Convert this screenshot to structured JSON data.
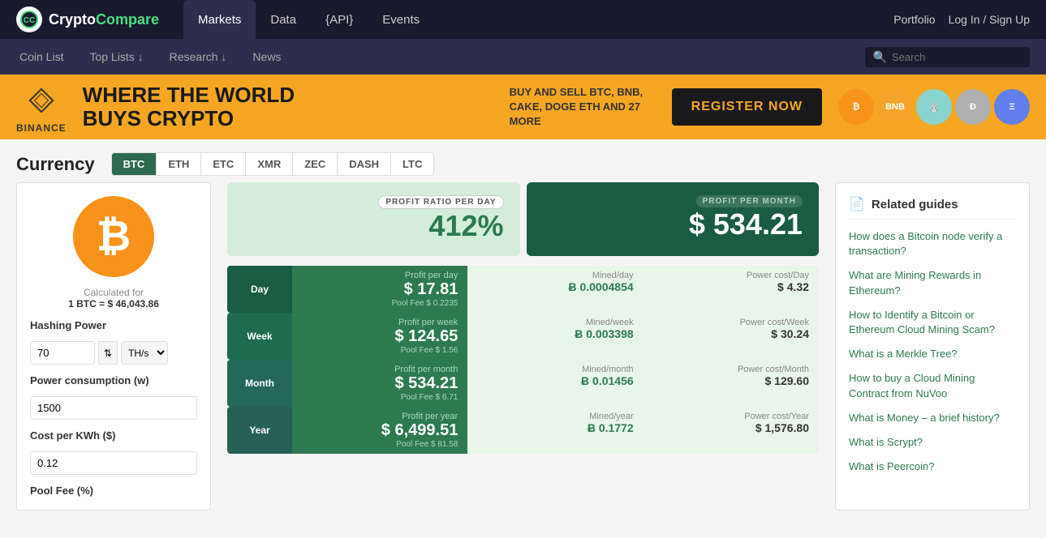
{
  "site": {
    "logo_text_crypto": "Crypto",
    "logo_text_compare": "Compare"
  },
  "top_nav": {
    "links": [
      {
        "label": "Markets",
        "active": true
      },
      {
        "label": "Data",
        "active": false
      },
      {
        "label": "{API}",
        "active": false
      },
      {
        "label": "Events",
        "active": false
      }
    ],
    "portfolio": "Portfolio",
    "login": "Log In / Sign Up"
  },
  "second_nav": {
    "links": [
      {
        "label": "Coin List"
      },
      {
        "label": "Top Lists ↓"
      },
      {
        "label": "Research ↓"
      },
      {
        "label": "News"
      }
    ],
    "search_placeholder": "Search"
  },
  "banner": {
    "brand": "BINANCE",
    "headline_line1": "WHERE THE WORLD",
    "headline_line2": "BUYS CRYPTO",
    "sub_text": "BUY AND SELL BTC, BNB, CAKE, DOGE ETH AND 27 MORE",
    "cta": "REGISTER NOW"
  },
  "currency": {
    "title": "Currency",
    "tabs": [
      "BTC",
      "ETH",
      "ETC",
      "XMR",
      "ZEC",
      "DASH",
      "LTC"
    ],
    "active_tab": "BTC"
  },
  "calc": {
    "rate_label": "Calculated for",
    "rate_value": "1 BTC = $ 46,043.86",
    "hashing_power_label": "Hashing Power",
    "hashing_power_value": "70",
    "hashing_unit": "TH/s",
    "power_consumption_label": "Power consumption (w)",
    "power_consumption_value": "1500",
    "cost_per_kwh_label": "Cost per KWh ($)",
    "cost_per_kwh_value": "0.12",
    "pool_fee_label": "Pool Fee (%)"
  },
  "profit_summary": {
    "day_label": "PROFIT RATIO PER DAY",
    "day_value": "412%",
    "month_label": "PROFIT PER MONTH",
    "month_value": "$ 534.21"
  },
  "stat_rows": [
    {
      "period": "Day",
      "profit_title": "Profit per day",
      "profit_value": "$ 17.81",
      "pool_fee": "Pool Fee $ 0.2235",
      "mined_title": "Mined/day",
      "mined_value": "Ƀ 0.0004854",
      "power_title": "Power cost/Day",
      "power_value": "$ 4.32"
    },
    {
      "period": "Week",
      "profit_title": "Profit per week",
      "profit_value": "$ 124.65",
      "pool_fee": "Pool Fee $ 1.56",
      "mined_title": "Mined/week",
      "mined_value": "Ƀ 0.003398",
      "power_title": "Power cost/Week",
      "power_value": "$ 30.24"
    },
    {
      "period": "Month",
      "profit_title": "Profit per month",
      "profit_value": "$ 534.21",
      "pool_fee": "Pool Fee $ 6.71",
      "mined_title": "Mined/month",
      "mined_value": "Ƀ 0.01456",
      "power_title": "Power cost/Month",
      "power_value": "$ 129.60"
    },
    {
      "period": "Year",
      "profit_title": "Profit per year",
      "profit_value": "$ 6,499.51",
      "pool_fee": "Pool Fee $ 81.58",
      "mined_title": "Mined/year",
      "mined_value": "Ƀ 0.1772",
      "power_title": "Power cost/Year",
      "power_value": "$ 1,576.80"
    }
  ],
  "guides": {
    "title": "Related guides",
    "links": [
      "How does a Bitcoin node verify a transaction?",
      "What are Mining Rewards in Ethereum?",
      "How to Identify a Bitcoin or Ethereum Cloud Mining Scam?",
      "What is a Merkle Tree?",
      "How to buy a Cloud Mining Contract from NuVoo",
      "What is Money – a brief history?",
      "What is Scrypt?",
      "What is Peercoin?"
    ]
  }
}
